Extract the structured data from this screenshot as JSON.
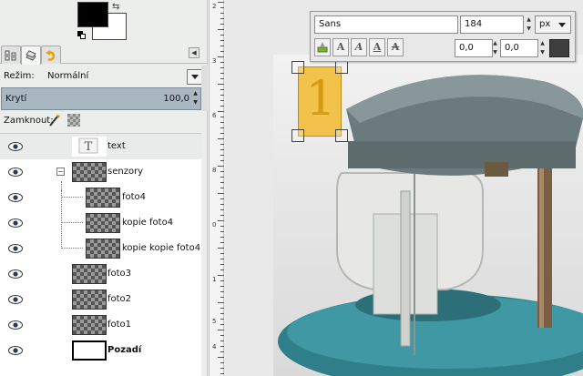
{
  "layer_mode": {
    "label": "Režim:",
    "value": "Normální"
  },
  "opacity": {
    "label": "Krytí",
    "value": "100,0"
  },
  "lock": {
    "label": "Zamknout:"
  },
  "layers": [
    {
      "name": "text",
      "type": "text",
      "visible": true,
      "selected": true
    },
    {
      "name": "senzory",
      "type": "group",
      "visible": true,
      "expanded": true
    },
    {
      "name": "foto4",
      "type": "layer",
      "visible": true,
      "indent": 1
    },
    {
      "name": "kopie foto4",
      "type": "layer",
      "visible": true,
      "indent": 1
    },
    {
      "name": "kopie kopie foto4",
      "type": "layer",
      "visible": true,
      "indent": 1
    },
    {
      "name": "foto3",
      "type": "layer",
      "visible": true
    },
    {
      "name": "foto2",
      "type": "layer",
      "visible": true
    },
    {
      "name": "foto1",
      "type": "layer",
      "visible": true
    },
    {
      "name": "Pozadí",
      "type": "background",
      "visible": true
    }
  ],
  "ruler": {
    "labels": [
      "2",
      "3",
      "6",
      "8",
      "0",
      "1",
      "5",
      "4"
    ]
  },
  "text_tool": {
    "font": "Sans",
    "size": "184",
    "unit": "px",
    "offset_x": "0,0",
    "offset_y": "0,0",
    "text_color": "#404040"
  },
  "text_box": {
    "content": "1",
    "fill": "#f3c24a"
  },
  "colors": {
    "foreground": "#000000",
    "background": "#ffffff",
    "selection": "#a9b7c3"
  }
}
